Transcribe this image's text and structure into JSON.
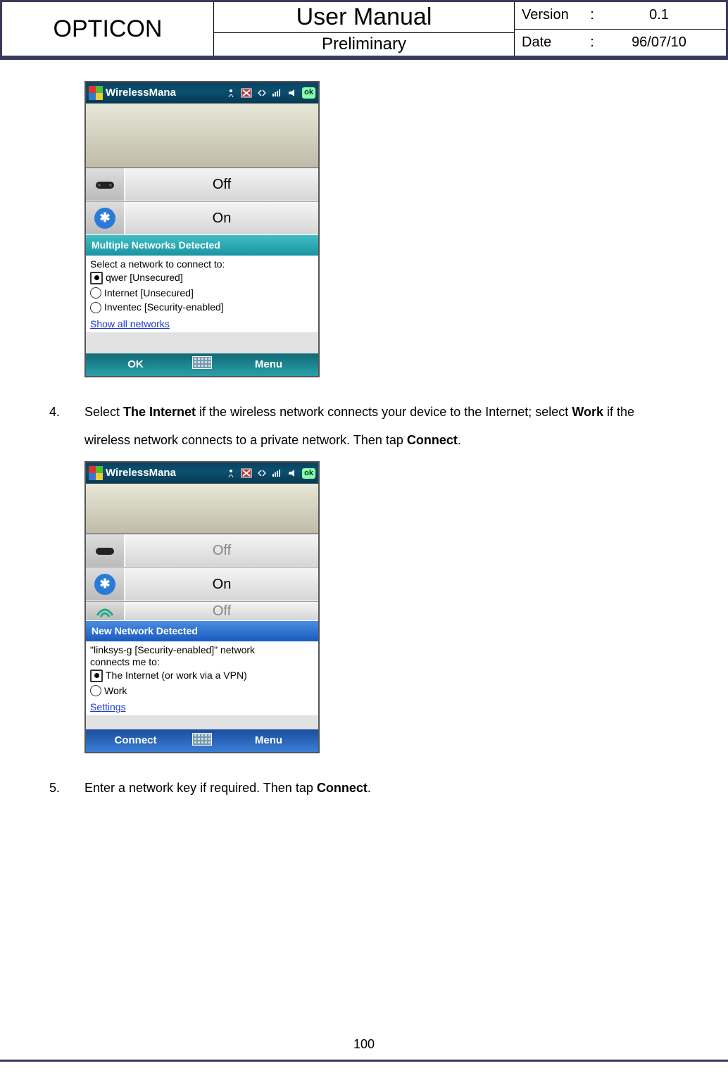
{
  "header": {
    "brand": "OPTICON",
    "title": "User Manual",
    "subtitle": "Preliminary",
    "version_label": "Version",
    "version_value": "0.1",
    "date_label": "Date",
    "date_value": "96/07/10",
    "colon": ":"
  },
  "screenshot1": {
    "titlebar_app": "WirelessMana",
    "ok_label": "ok",
    "toggle_phone": "Off",
    "toggle_bt": "On",
    "dialog_title": "Multiple Networks Detected",
    "prompt": "Select a network to connect to:",
    "radios": [
      {
        "label": "qwer [Unsecured]",
        "selected": true
      },
      {
        "label": "Internet [Unsecured]",
        "selected": false
      },
      {
        "label": "Inventec [Security-enabled]",
        "selected": false
      }
    ],
    "link": "Show all networks",
    "left_button": "OK",
    "right_button": "Menu"
  },
  "step4": {
    "number": "4.",
    "pre": "Select ",
    "bold1": "The Internet",
    "mid1": " if the wireless network connects your device to the Internet; select ",
    "bold2": "Work",
    "mid2": " if the wireless network connects to a private network. Then tap ",
    "bold3": "Connect",
    "post": "."
  },
  "screenshot2": {
    "titlebar_app": "WirelessMana",
    "ok_label": "ok",
    "toggle_phone": "Off",
    "toggle_bt": "On",
    "toggle_wifi": "Off",
    "dialog_title": "New Network Detected",
    "prompt_line1": "\"linksys-g [Security-enabled]\" network",
    "prompt_line2": "connects me to:",
    "radios": [
      {
        "label": "The Internet (or work via a VPN)",
        "selected": true
      },
      {
        "label": "Work",
        "selected": false
      }
    ],
    "link": "Settings",
    "left_button": "Connect",
    "right_button": "Menu"
  },
  "step5": {
    "number": "5.",
    "pre": "Enter a network key if required. Then tap ",
    "bold1": "Connect",
    "post": "."
  },
  "page_number": "100"
}
